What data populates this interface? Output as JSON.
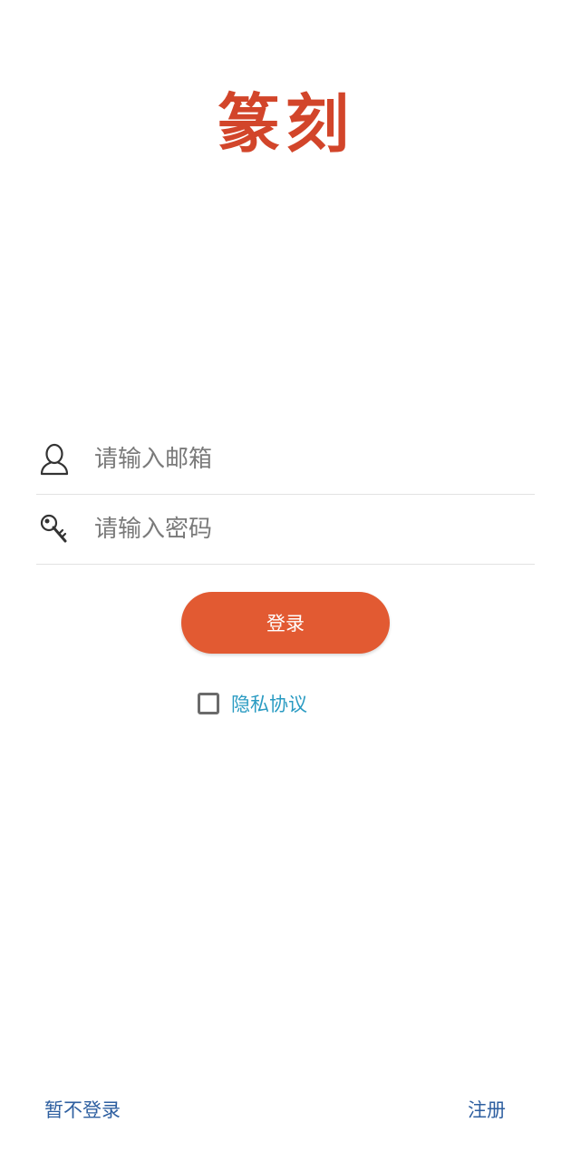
{
  "app": {
    "logo_text": "篆刻"
  },
  "form": {
    "email": {
      "placeholder": "请输入邮箱",
      "value": "",
      "icon": "user-icon"
    },
    "password": {
      "placeholder": "请输入密码",
      "value": "",
      "icon": "key-icon"
    },
    "login_label": "登录",
    "privacy": {
      "checked": false,
      "label": "隐私协议"
    }
  },
  "footer": {
    "skip_label": "暂不登录",
    "register_label": "注册"
  },
  "colors": {
    "brand": "#d2452a",
    "button": "#e25a32",
    "link": "#2a9bc2",
    "footer_link": "#2e5fa0"
  }
}
